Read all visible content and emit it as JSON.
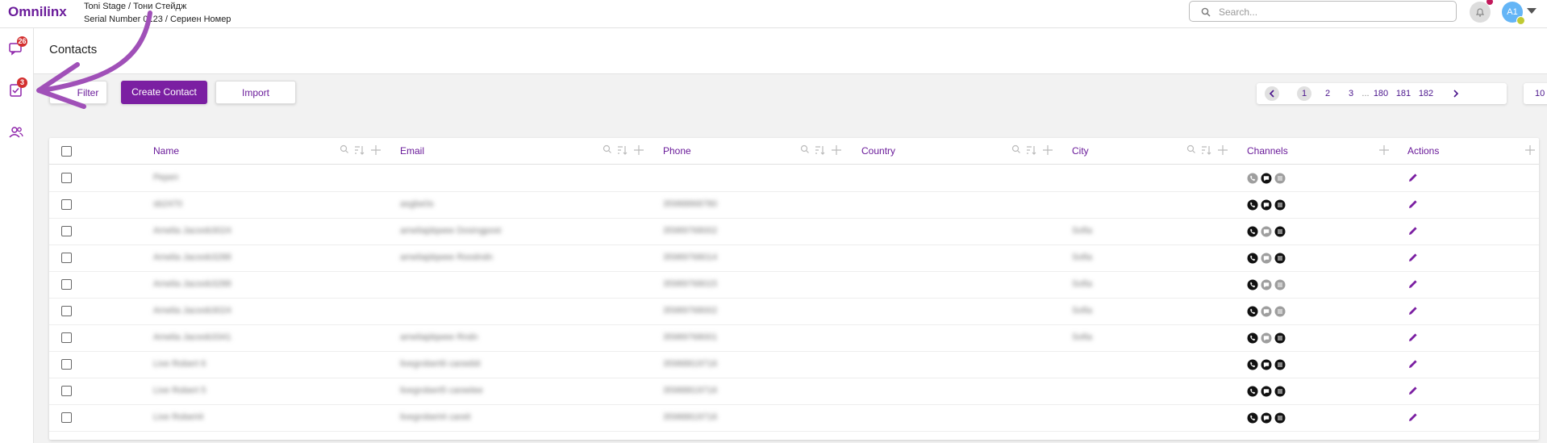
{
  "app": {
    "logo": "Omnilinx",
    "tenant_line1": "Toni Stage / Тони Стейдж",
    "tenant_line2": "Serial Number 0123 / Сериен Номер"
  },
  "header": {
    "search_placeholder": "Search...",
    "avatar_initials": "A1"
  },
  "sidebar": {
    "items": [
      {
        "name": "conversations",
        "icon": "chat-icon",
        "badge": "26"
      },
      {
        "name": "tasks",
        "icon": "task-check-icon",
        "badge": "3"
      },
      {
        "name": "contacts",
        "icon": "contacts-icon",
        "badge": ""
      }
    ]
  },
  "page": {
    "title": "Contacts"
  },
  "toolbar": {
    "filter_label": "Filter",
    "create_label": "Create Contact",
    "import_label": "Import"
  },
  "pagination": {
    "pages": [
      "1",
      "2",
      "3",
      "...",
      "180",
      "181",
      "182"
    ],
    "current": "1",
    "page_size": "10"
  },
  "table": {
    "columns": [
      "Name",
      "Email",
      "Phone",
      "Country",
      "City",
      "Channels",
      "Actions"
    ],
    "rows": [
      {
        "name": "Ререп",
        "email": "",
        "phone": "",
        "country": "",
        "city": "",
        "channels": [
          "phone-muted",
          "chat",
          "email-muted"
        ]
      },
      {
        "name": "sb2470",
        "email": "asgbe0s",
        "phone": "35988868780",
        "country": "",
        "city": "",
        "channels": [
          "phone",
          "chat",
          "email"
        ]
      },
      {
        "name": "Amelia Jacoob3024",
        "email": "ameliajdqwee Dosingpost",
        "phone": "35989768002",
        "country": "",
        "city": "Sofia",
        "channels": [
          "phone",
          "chat-muted",
          "email"
        ]
      },
      {
        "name": "Amelia Jacoob3288",
        "email": "ameliajdqwee Roodndn",
        "phone": "35989768014",
        "country": "",
        "city": "Sofia",
        "channels": [
          "phone",
          "chat-muted",
          "email"
        ]
      },
      {
        "name": "Amelia Jacoob3288",
        "email": "",
        "phone": "35989768015",
        "country": "",
        "city": "Sofia",
        "channels": [
          "phone",
          "chat-muted",
          "email-muted"
        ]
      },
      {
        "name": "Amelia Jacoob3024",
        "email": "",
        "phone": "35989768002",
        "country": "",
        "city": "Sofia",
        "channels": [
          "phone",
          "chat-muted",
          "email-muted"
        ]
      },
      {
        "name": "Amelia Jacoob3341",
        "email": "ameliajdqwee Rndn",
        "phone": "35989768001",
        "country": "",
        "city": "Sofia",
        "channels": [
          "phone",
          "chat-muted",
          "email"
        ]
      },
      {
        "name": "Live Robert 6",
        "email": "livegrobert6 careebit",
        "phone": "35988819716",
        "country": "",
        "city": "",
        "channels": [
          "phone",
          "chat",
          "email"
        ]
      },
      {
        "name": "Live Robert 5",
        "email": "livegrobert5 careelee",
        "phone": "35988819716",
        "country": "",
        "city": "",
        "channels": [
          "phone",
          "chat",
          "email"
        ]
      },
      {
        "name": "Live Robert4",
        "email": "livegrobert4 careit",
        "phone": "35988819716",
        "country": "",
        "city": "",
        "channels": [
          "phone",
          "chat",
          "email"
        ]
      }
    ]
  },
  "colors": {
    "brand": "#7b1fa2",
    "accent_text": "#6a1b9a",
    "badge": "#d32f2f",
    "annotation_arrow": "#a050b8"
  }
}
